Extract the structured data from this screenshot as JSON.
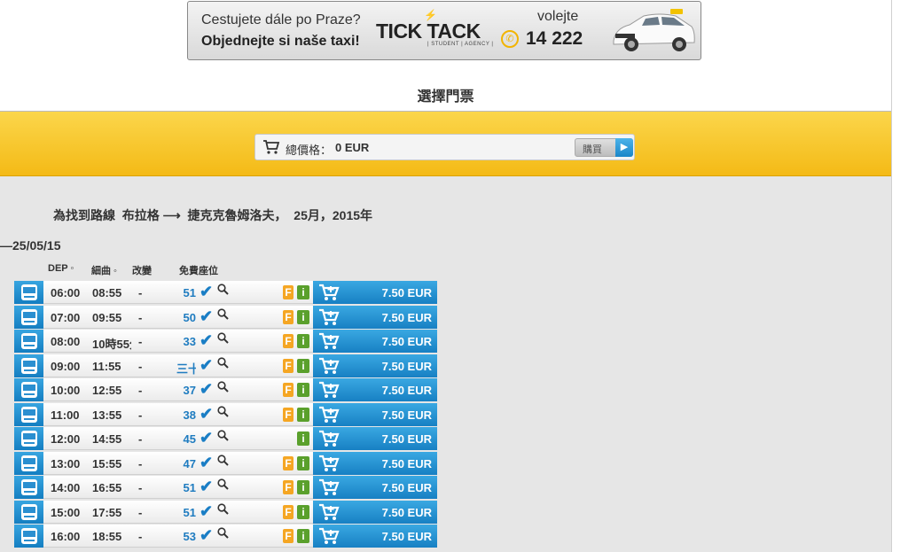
{
  "banner": {
    "line1": "Cestujete dále po Praze?",
    "line2": "Objednejte si naše taxi!",
    "logo": "TICK TACK",
    "logo_sub": "| STUDENT | AGENCY |",
    "volejte": "volejte",
    "phone": "14 222"
  },
  "page_title": "選擇門票",
  "total": {
    "label": "總價格：",
    "value": "0 EUR",
    "buy_label": "購買"
  },
  "route_line": "為找到路線  布拉格 ⟶  捷克克魯姆洛夫，  25月，2015年",
  "date_header": "—25/05/15",
  "columns": {
    "dep": "DEP",
    "arr": "細曲",
    "change": "改變",
    "seats": "免費座位"
  },
  "colors": {
    "accent_blue": "#1a86c8",
    "yellow": "#f4ba16",
    "f_badge": "#f5a623",
    "i_badge": "#5aa02c"
  },
  "rows": [
    {
      "dep": "06:00",
      "arr": "08:55",
      "change": "-",
      "seats": "51",
      "f": "F",
      "i": "i",
      "price": "7.50 EUR"
    },
    {
      "dep": "07:00",
      "arr": "09:55",
      "change": "-",
      "seats": "50",
      "f": "F",
      "i": "i",
      "price": "7.50 EUR"
    },
    {
      "dep": "08:00",
      "arr": "10時55分",
      "change": "-",
      "seats": "33",
      "f": "F",
      "i": "i",
      "price": "7.50 EUR"
    },
    {
      "dep": "09:00",
      "arr": "11:55",
      "change": "-",
      "seats": "三十",
      "f": "F",
      "i": "i",
      "price": "7.50 EUR"
    },
    {
      "dep": "10:00",
      "arr": "12:55",
      "change": "-",
      "seats": "37",
      "f": "F",
      "i": "i",
      "price": "7.50 EUR"
    },
    {
      "dep": "11:00",
      "arr": "13:55",
      "change": "-",
      "seats": "38",
      "f": "F",
      "i": "i",
      "price": "7.50 EUR"
    },
    {
      "dep": "12:00",
      "arr": "14:55",
      "change": "-",
      "seats": "45",
      "f": "",
      "i": "i",
      "price": "7.50 EUR"
    },
    {
      "dep": "13:00",
      "arr": "15:55",
      "change": "-",
      "seats": "47",
      "f": "F",
      "i": "i",
      "price": "7.50 EUR"
    },
    {
      "dep": "14:00",
      "arr": "16:55",
      "change": "-",
      "seats": "51",
      "f": "F",
      "i": "i",
      "price": "7.50 EUR"
    },
    {
      "dep": "15:00",
      "arr": "17:55",
      "change": "-",
      "seats": "51",
      "f": "F",
      "i": "i",
      "price": "7.50 EUR"
    },
    {
      "dep": "16:00",
      "arr": "18:55",
      "change": "-",
      "seats": "53",
      "f": "F",
      "i": "i",
      "price": "7.50 EUR"
    }
  ]
}
